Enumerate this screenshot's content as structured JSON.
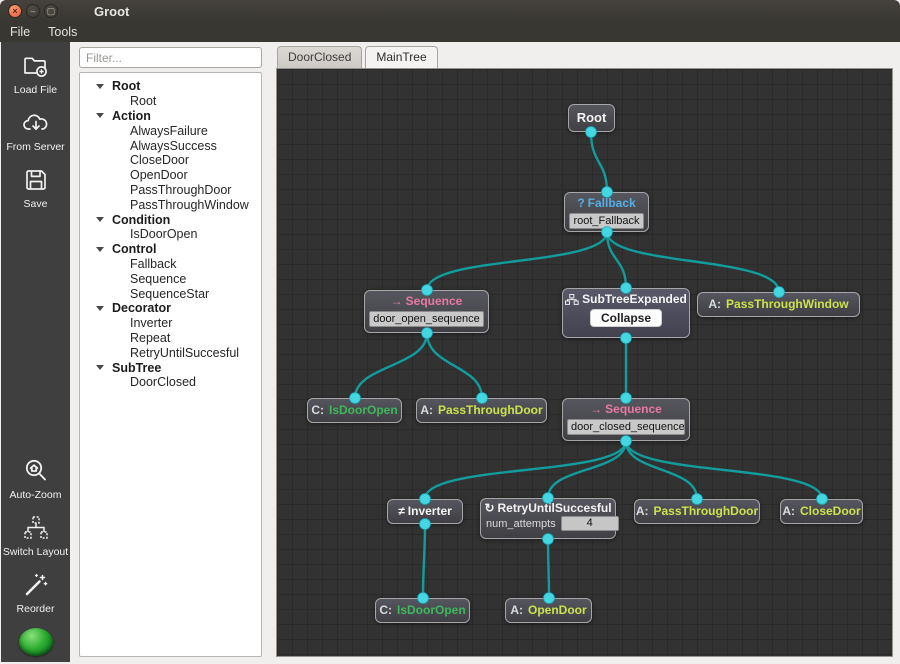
{
  "window": {
    "title": "Groot",
    "menu": [
      "File",
      "Tools"
    ]
  },
  "toolbar": {
    "items": [
      {
        "label": "Load File",
        "icon": "folder-plus-icon"
      },
      {
        "label": "From Server",
        "icon": "cloud-download-icon"
      },
      {
        "label": "Save",
        "icon": "floppy-disk-icon"
      },
      {
        "label": "Auto-Zoom",
        "icon": "magnifier-home-icon"
      },
      {
        "label": "Switch Layout",
        "icon": "tree-layout-icon"
      },
      {
        "label": "Reorder",
        "icon": "magic-wand-icon"
      }
    ],
    "status_led_color": "#2fae33"
  },
  "palette": {
    "filter_placeholder": "Filter...",
    "categories": [
      {
        "label": "Root",
        "children": [
          "Root"
        ]
      },
      {
        "label": "Action",
        "children": [
          "AlwaysFailure",
          "AlwaysSuccess",
          "CloseDoor",
          "OpenDoor",
          "PassThroughDoor",
          "PassThroughWindow"
        ]
      },
      {
        "label": "Condition",
        "children": [
          "IsDoorOpen"
        ]
      },
      {
        "label": "Control",
        "children": [
          "Fallback",
          "Sequence",
          "SequenceStar"
        ]
      },
      {
        "label": "Decorator",
        "children": [
          "Inverter",
          "Repeat",
          "RetryUntilSuccesful"
        ]
      },
      {
        "label": "SubTree",
        "children": [
          "DoorClosed"
        ]
      }
    ]
  },
  "tabs": [
    {
      "label": "DoorClosed",
      "active": false
    },
    {
      "label": "MainTree",
      "active": true
    }
  ],
  "graph": {
    "colors": {
      "edge": "#129c9e",
      "port": "#44d7e2",
      "control_title": "#e879a2",
      "fallback_title": "#56aee4",
      "action_title": "#cde24c",
      "condition_title": "#3eb85a",
      "canvas_bg": "#323232"
    },
    "nodes": {
      "root": {
        "title": "Root"
      },
      "fallback": {
        "icon_glyph": "?",
        "title": "Fallback",
        "instance": "root_Fallback"
      },
      "seq_open": {
        "icon_glyph": "→",
        "title": "Sequence",
        "instance": "door_open_sequence"
      },
      "subtree": {
        "title": "SubTreeExpanded",
        "button_label": "Collapse"
      },
      "pass_window": {
        "prefix": "A:",
        "title": "PassThroughWindow"
      },
      "is_door_open_1": {
        "prefix": "C:",
        "title": "IsDoorOpen"
      },
      "pass_door_1": {
        "prefix": "A:",
        "title": "PassThroughDoor"
      },
      "seq_closed": {
        "icon_glyph": "→",
        "title": "Sequence",
        "instance": "door_closed_sequence"
      },
      "inverter": {
        "icon_glyph": "≠",
        "title": "Inverter"
      },
      "retry": {
        "icon_glyph": "↻",
        "title": "RetryUntilSuccesful",
        "param_label": "num_attempts",
        "param_value": "4"
      },
      "pass_door_2": {
        "prefix": "A:",
        "title": "PassThroughDoor"
      },
      "close_door": {
        "prefix": "A:",
        "title": "CloseDoor"
      },
      "is_door_open_2": {
        "prefix": "C:",
        "title": "IsDoorOpen"
      },
      "open_door": {
        "prefix": "A:",
        "title": "OpenDoor"
      }
    }
  }
}
